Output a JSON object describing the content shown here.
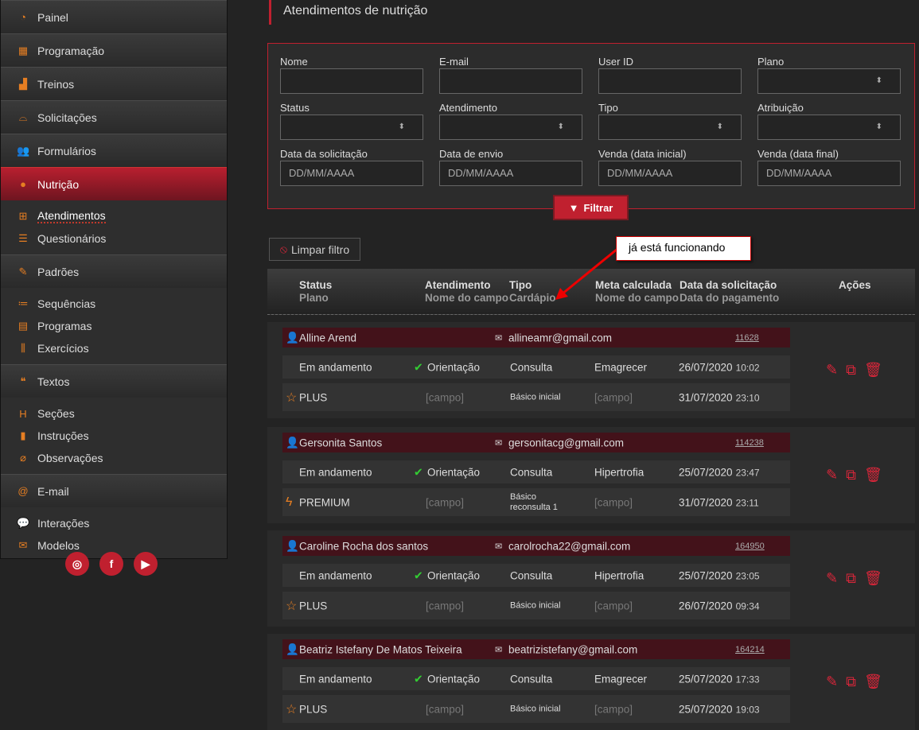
{
  "sidebar": {
    "groups": [
      {
        "label": "Painel",
        "icon": "◔",
        "name": "gauge-icon"
      },
      {
        "label": "Programação",
        "icon": "▦",
        "name": "calendar-icon"
      },
      {
        "label": "Treinos",
        "icon": "▟",
        "name": "bar-chart-icon"
      },
      {
        "label": "Solicitações",
        "icon": "⌓",
        "name": "inbox-icon"
      },
      {
        "label": "Formulários",
        "icon": "👥",
        "name": "users-icon"
      },
      {
        "label": "Nutrição",
        "icon": "●",
        "name": "apple-icon",
        "active": true,
        "subs": [
          {
            "label": "Atendimentos",
            "icon": "⊞",
            "name": "laptop-icon",
            "current": true
          },
          {
            "label": "Questionários",
            "icon": "☰",
            "name": "list-icon"
          }
        ]
      },
      {
        "label": "Padrões",
        "icon": "✎",
        "name": "edit-icon",
        "subs": [
          {
            "label": "Sequências",
            "icon": "≔",
            "name": "ordered-list-icon"
          },
          {
            "label": "Programas",
            "icon": "▤",
            "name": "archive-icon"
          },
          {
            "label": "Exercícios",
            "icon": "⫼",
            "name": "dumbbell-icon"
          }
        ]
      },
      {
        "label": "Textos",
        "icon": "❝",
        "name": "quote-icon",
        "subs": [
          {
            "label": "Seções",
            "icon": "H",
            "name": "heading-icon"
          },
          {
            "label": "Instruções",
            "icon": "▮",
            "name": "book-icon"
          },
          {
            "label": "Observações",
            "icon": "⌀",
            "name": "paperclip-icon"
          }
        ]
      },
      {
        "label": "E-mail",
        "icon": "@",
        "name": "at-icon",
        "subs": [
          {
            "label": "Interações",
            "icon": "💬",
            "name": "comments-icon"
          },
          {
            "label": "Modelos",
            "icon": "✉",
            "name": "envelope-icon"
          }
        ]
      }
    ],
    "social": [
      {
        "label": "◎",
        "name": "instagram-icon"
      },
      {
        "label": "f",
        "name": "facebook-icon"
      },
      {
        "label": "▶",
        "name": "youtube-icon"
      }
    ]
  },
  "page_title": "Atendimentos de nutrição",
  "filters": [
    {
      "label": "Nome",
      "value": "",
      "type": "text"
    },
    {
      "label": "E-mail",
      "value": "",
      "type": "text"
    },
    {
      "label": "User ID",
      "value": "",
      "type": "text"
    },
    {
      "label": "Plano",
      "value": "",
      "type": "select"
    },
    {
      "label": "Status",
      "value": "",
      "type": "select"
    },
    {
      "label": "Atendimento",
      "value": "",
      "type": "select"
    },
    {
      "label": "Tipo",
      "value": "",
      "type": "select"
    },
    {
      "label": "Atribuição",
      "value": "",
      "type": "select"
    },
    {
      "label": "Data da solicitação",
      "value": "DD/MM/AAAA",
      "type": "text"
    },
    {
      "label": "Data de envio",
      "value": "DD/MM/AAAA",
      "type": "text"
    },
    {
      "label": "Venda (data inicial)",
      "value": "DD/MM/AAAA",
      "type": "text"
    },
    {
      "label": "Venda (data final)",
      "value": "DD/MM/AAAA",
      "type": "text"
    }
  ],
  "filter_button": "Filtrar",
  "clear_button": "Limpar filtro",
  "annotation": "já está funcionando",
  "table": {
    "headers": [
      {
        "top": "Status",
        "bottom": "Plano"
      },
      {
        "top": "Atendimento",
        "bottom": "Nome do campo"
      },
      {
        "top": "Tipo",
        "bottom": "Cardápio"
      },
      {
        "top": "Meta calculada",
        "bottom": "Nome do campo"
      },
      {
        "top": "Data da solicitação",
        "bottom": "Data do pagamento"
      },
      {
        "top": "Ações",
        "bottom": ""
      }
    ],
    "rows": [
      {
        "name": "Alline Arend",
        "email": "allineamr@gmail.com",
        "id": "11628",
        "status": "Em andamento",
        "atendimento": "Orientação",
        "tipo": "Consulta",
        "meta": "Emagrecer",
        "date1": "26/07/2020",
        "time1": "10:02",
        "plan": "PLUS",
        "plan_icon": "☆",
        "campo1": "[campo]",
        "cardapio": "Básico inicial",
        "campo2": "[campo]",
        "date2": "31/07/2020",
        "time2": "23:10"
      },
      {
        "name": "Gersonita Santos",
        "email": "gersonitacg@gmail.com",
        "id": "114238",
        "status": "Em andamento",
        "atendimento": "Orientação",
        "tipo": "Consulta",
        "meta": "Hipertrofia",
        "date1": "25/07/2020",
        "time1": "23:47",
        "plan": "PREMIUM",
        "plan_icon": "ϟ",
        "campo1": "[campo]",
        "cardapio": "Básico reconsulta 1",
        "campo2": "[campo]",
        "date2": "31/07/2020",
        "time2": "23:11"
      },
      {
        "name": "Caroline Rocha dos santos",
        "email": "carolrocha22@gmail.com",
        "id": "164950",
        "status": "Em andamento",
        "atendimento": "Orientação",
        "tipo": "Consulta",
        "meta": "Hipertrofia",
        "date1": "25/07/2020",
        "time1": "23:05",
        "plan": "PLUS",
        "plan_icon": "☆",
        "campo1": "[campo]",
        "cardapio": "Básico inicial",
        "campo2": "[campo]",
        "date2": "26/07/2020",
        "time2": "09:34"
      },
      {
        "name": "Beatriz Istefany De Matos Teixeira",
        "email": "beatrizistefany@gmail.com",
        "id": "164214",
        "status": "Em andamento",
        "atendimento": "Orientação",
        "tipo": "Consulta",
        "meta": "Emagrecer",
        "date1": "25/07/2020",
        "time1": "17:33",
        "plan": "PLUS",
        "plan_icon": "☆",
        "campo1": "[campo]",
        "cardapio": "Básico inicial",
        "campo2": "[campo]",
        "date2": "25/07/2020",
        "time2": "19:03"
      }
    ]
  },
  "colors": {
    "accent": "#c0202f",
    "icon_orange": "#e67e22",
    "row_header": "#43121a"
  }
}
